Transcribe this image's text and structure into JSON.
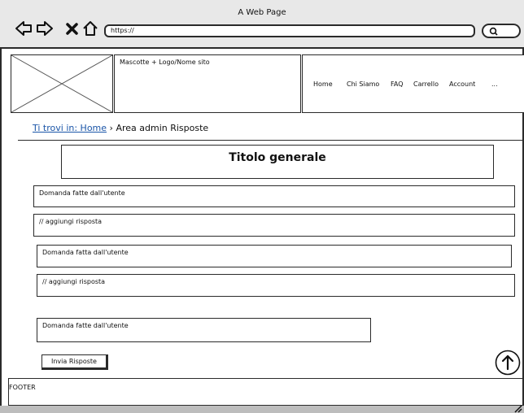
{
  "window": {
    "title": "A Web Page"
  },
  "browser": {
    "url": "https://"
  },
  "header": {
    "logo_text": "Mascotte + Logo/Nome sito",
    "menu": [
      "Home",
      "Chi Siamo",
      "FAQ",
      "Carrello",
      "Account",
      "..."
    ]
  },
  "breadcrumb": {
    "link": "Ti trovi in: Home",
    "separator": "›",
    "current": "Area admin Risposte"
  },
  "main": {
    "title": "Titolo generale",
    "fields": [
      "Domanda fatte dall'utente",
      "// aggiungi risposta",
      "Domanda fatta dall'utente",
      "// aggiungi risposta",
      "Domanda fatte dall'utente"
    ],
    "submit_label": "Invia Risposte"
  },
  "footer": {
    "label": "FOOTER"
  }
}
